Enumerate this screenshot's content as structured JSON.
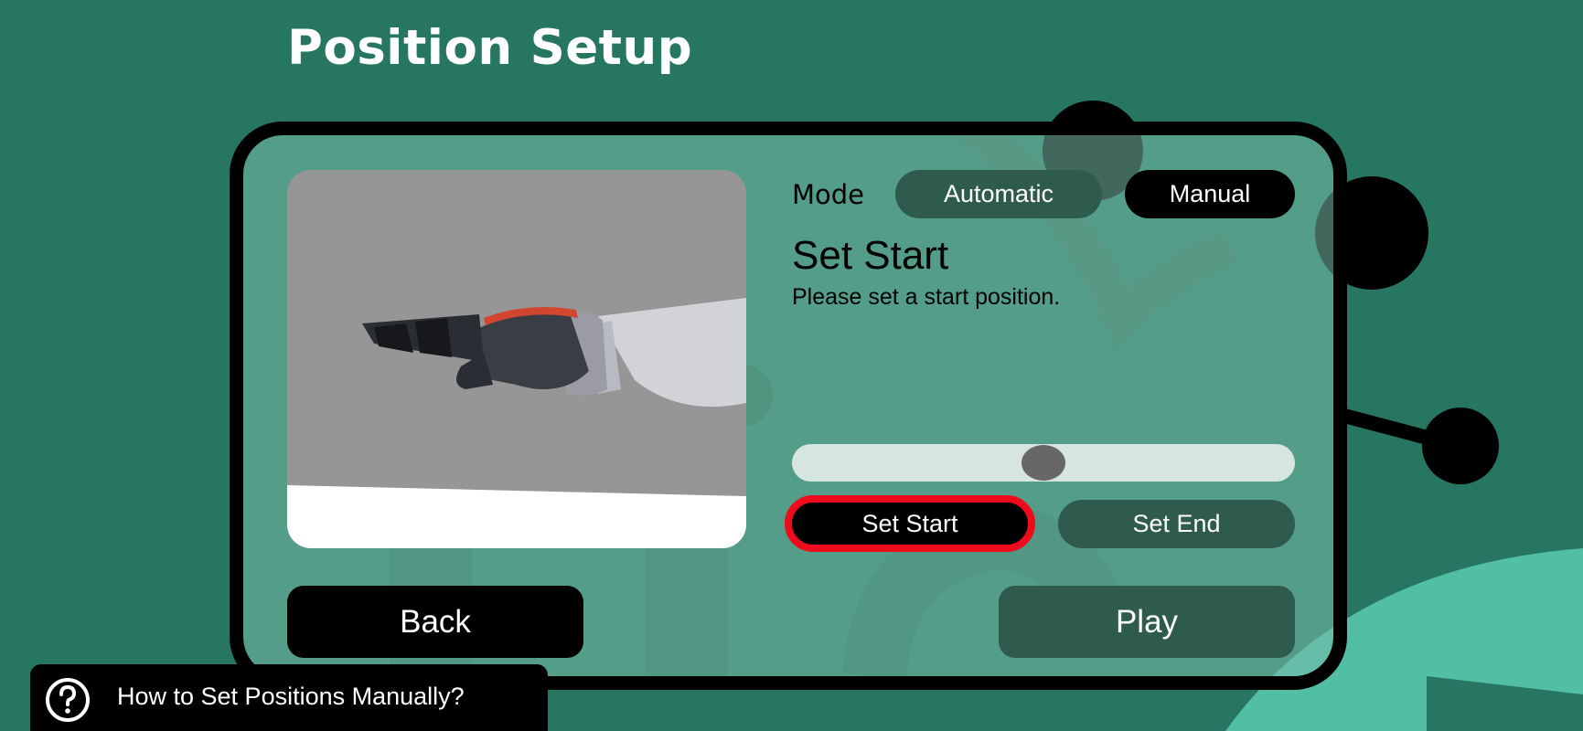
{
  "page": {
    "title": "Position Setup"
  },
  "mode": {
    "label": "Mode",
    "automatic_label": "Automatic",
    "manual_label": "Manual",
    "selected": "Manual"
  },
  "step": {
    "title": "Set Start",
    "description": "Please set a start position."
  },
  "slider": {
    "value": 0.5
  },
  "actions": {
    "set_start_label": "Set Start",
    "set_end_label": "Set End",
    "active": "Set Start"
  },
  "nav": {
    "back_label": "Back",
    "play_label": "Play"
  },
  "help": {
    "text": "How to Set Positions Manually?",
    "icon": "question-circle-icon"
  },
  "preview": {
    "subject": "robotic-hand"
  },
  "colors": {
    "background": "#267662",
    "panel_border": "#000000",
    "button_dark": "#000000",
    "button_muted": "#2f5a4e",
    "highlight": "#ee0b1c",
    "slider_track": "#d7e5e0",
    "slider_thumb": "#676767",
    "decoration_light": "#52bea6"
  }
}
